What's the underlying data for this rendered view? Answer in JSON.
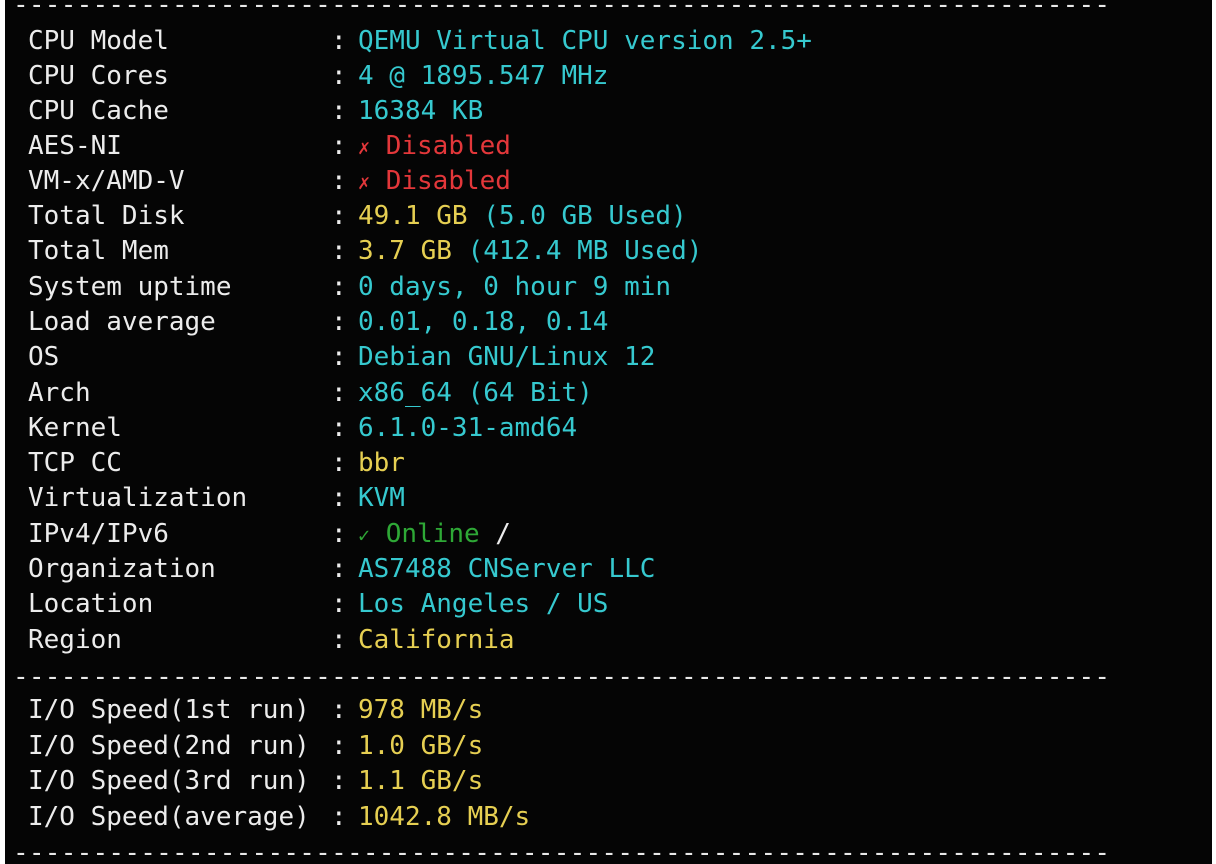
{
  "divider": "----------------------------------------------------------------------",
  "system": [
    {
      "label": "CPU Model",
      "value": "QEMU Virtual CPU version 2.5+",
      "color": "#36c9cf"
    },
    {
      "label": "CPU Cores",
      "value": "4 @ 1895.547 MHz",
      "color": "#36c9cf"
    },
    {
      "label": "CPU Cache",
      "value": "16384 KB",
      "color": "#36c9cf"
    },
    {
      "label": "AES-NI",
      "mark": "✗",
      "value": "Disabled",
      "color": "#e3373a"
    },
    {
      "label": "VM-x/AMD-V",
      "mark": "✗",
      "value": "Disabled",
      "color": "#e3373a"
    },
    {
      "label": "Total Disk",
      "value_main": "49.1 GB",
      "value_extra": "(5.0 GB Used)",
      "color": "#e6cf52",
      "extra_color": "#36c9cf"
    },
    {
      "label": "Total Mem",
      "value_main": "3.7 GB",
      "value_extra": "(412.4 MB Used)",
      "color": "#e6cf52",
      "extra_color": "#36c9cf"
    },
    {
      "label": "System uptime",
      "value": "0 days, 0 hour 9 min",
      "color": "#36c9cf"
    },
    {
      "label": "Load average",
      "value": "0.01, 0.18, 0.14",
      "color": "#36c9cf"
    },
    {
      "label": "OS",
      "value": "Debian GNU/Linux 12",
      "color": "#36c9cf"
    },
    {
      "label": "Arch",
      "value": "x86_64 (64 Bit)",
      "color": "#36c9cf"
    },
    {
      "label": "Kernel",
      "value": "6.1.0-31-amd64",
      "color": "#36c9cf"
    },
    {
      "label": "TCP CC",
      "value": "bbr",
      "color": "#e6cf52"
    },
    {
      "label": "Virtualization",
      "value": "KVM",
      "color": "#36c9cf"
    },
    {
      "label": "IPv4/IPv6",
      "mark": "✓",
      "value": "Online",
      "suffix": "/",
      "color": "#2ea836"
    },
    {
      "label": "Organization",
      "value": "AS7488 CNServer LLC",
      "color": "#36c9cf"
    },
    {
      "label": "Location",
      "value": "Los Angeles / US",
      "color": "#36c9cf"
    },
    {
      "label": "Region",
      "value": "California",
      "color": "#e6cf52"
    }
  ],
  "io": [
    {
      "label": "I/O Speed(1st run)",
      "value": "978 MB/s",
      "color": "#e6cf52"
    },
    {
      "label": "I/O Speed(2nd run)",
      "value": "1.0 GB/s",
      "color": "#e6cf52"
    },
    {
      "label": "I/O Speed(3rd run)",
      "value": "1.1 GB/s",
      "color": "#e6cf52"
    },
    {
      "label": "I/O Speed(average)",
      "value": "1042.8 MB/s",
      "color": "#e6cf52"
    }
  ],
  "separator": ":"
}
